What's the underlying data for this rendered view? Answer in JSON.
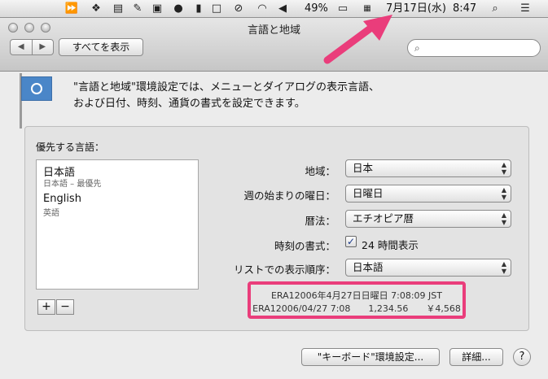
{
  "menubar": {
    "icons": [
      "fast-forward-icon",
      "dropbox-icon",
      "printer-icon",
      "note-icon",
      "contacts-icon",
      "media-icon",
      "bookmark-icon",
      "square-icon",
      "alert-icon",
      "wifi-icon",
      "volume-icon"
    ],
    "battery": "49%",
    "date": "7月17日(水)",
    "time": "8:47"
  },
  "window": {
    "title": "言語と地域",
    "show_all": "すべてを表示"
  },
  "intro": {
    "line1": "\"言語と地域\"環境設定では、メニューとダイアログの表示言語、",
    "line2": "および日付、時刻、通貨の書式を設定できます。"
  },
  "languages": {
    "heading": "優先する言語：",
    "items": [
      {
        "name": "日本語",
        "sub": "日本語 – 最優先"
      },
      {
        "name": "English",
        "sub": "英語"
      }
    ],
    "add": "+",
    "remove": "−"
  },
  "settings": {
    "region": {
      "label": "地域：",
      "value": "日本"
    },
    "week_start": {
      "label": "週の始まりの曜日：",
      "value": "日曜日"
    },
    "calendar": {
      "label": "暦法：",
      "value": "エチオピア暦"
    },
    "time_format": {
      "label": "時刻の書式：",
      "value": "24 時間表示",
      "checked": true
    },
    "list_order": {
      "label": "リストでの表示順序：",
      "value": "日本語"
    }
  },
  "preview": {
    "line1": "ERA12006年4月27日日曜日 7:08:09 JST",
    "line2": "ERA12006/04/27 7:08　　1,234.56　　￥4,568"
  },
  "buttons": {
    "keyboard": "\"キーボード\"環境設定...",
    "advanced": "詳細...",
    "help": "?"
  },
  "colors": {
    "highlight": "#ea3d7b"
  }
}
